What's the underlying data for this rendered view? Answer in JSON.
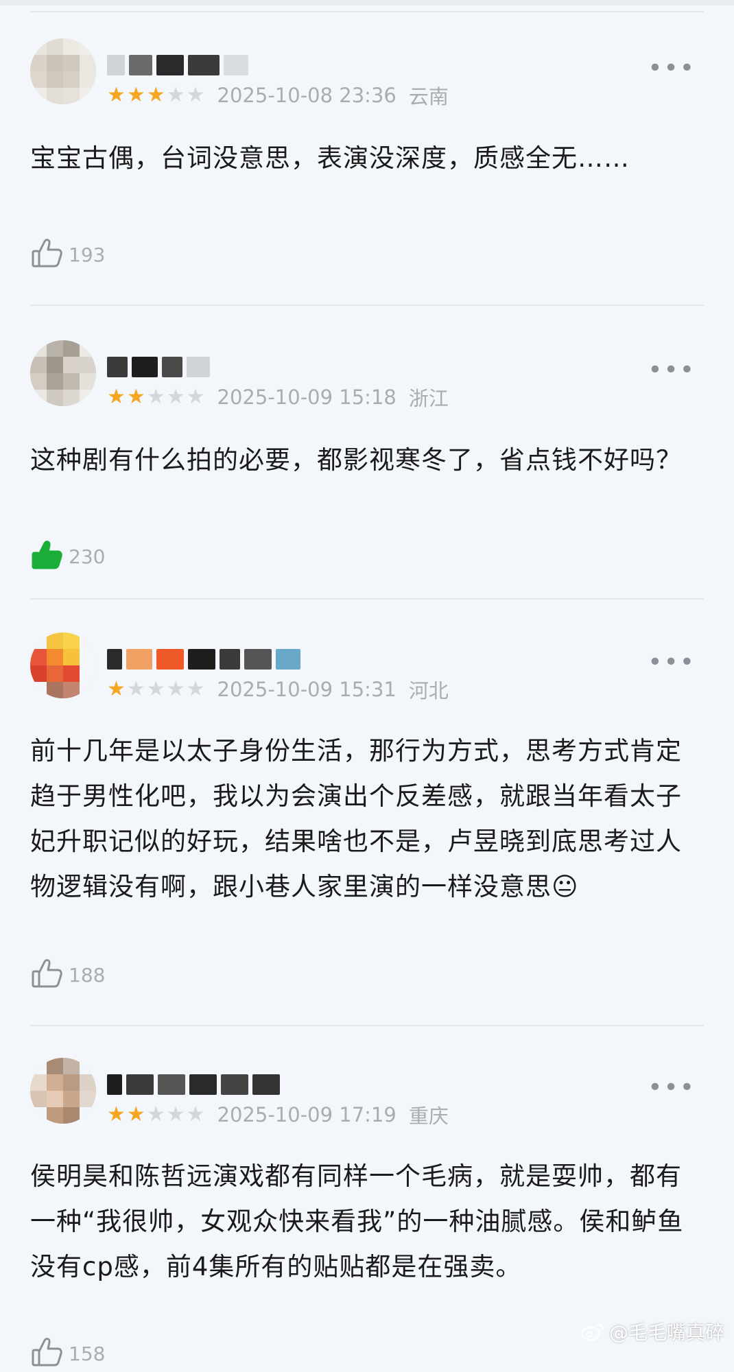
{
  "reviews": [
    {
      "username": "…",
      "rating": 3,
      "date": "2025-10-08 23:36",
      "location": "云南",
      "text": "宝宝古偶，台词没意思，表演没深度，质感全无……",
      "likes": "193",
      "liked": false
    },
    {
      "username": "…",
      "rating": 2,
      "date": "2025-10-09 15:18",
      "location": "浙江",
      "text": "这种剧有什么拍的必要，都影视寒冬了，省点钱不好吗？",
      "likes": "230",
      "liked": true
    },
    {
      "username": "…",
      "rating": 1,
      "date": "2025-10-09 15:31",
      "location": "河北",
      "text": "前十几年是以太子身份生活，那行为方式，思考方式肯定趋于男性化吧，我以为会演出个反差感，就跟当年看太子妃升职记似的好玩，结果啥也不是，卢昱晓到底思考过人物逻辑没有啊，跟小巷人家里演的一样没意思😐",
      "likes": "188",
      "liked": false
    },
    {
      "username": "…",
      "rating": 2,
      "date": "2025-10-09 17:19",
      "location": "重庆",
      "text": "侯明昊和陈哲远演戏都有同样一个毛病，就是耍帅，都有一种“我很帅，女观众快来看我”的一种油腻感。侯和鲈鱼没有cp感，前4集所有的贴贴都是在强卖。",
      "likes": "158",
      "liked": false
    }
  ],
  "more_label": "•••",
  "colors": {
    "star_on": "#f5a623",
    "star_off": "#d3d6db",
    "liked_green": "#1aad37",
    "meta_gray": "#a8adb4"
  },
  "icons": {
    "like": "thumbs-up-icon",
    "more": "more-dots-icon",
    "star": "star-icon"
  },
  "watermark": {
    "text": "@毛毛嘴真碎"
  }
}
